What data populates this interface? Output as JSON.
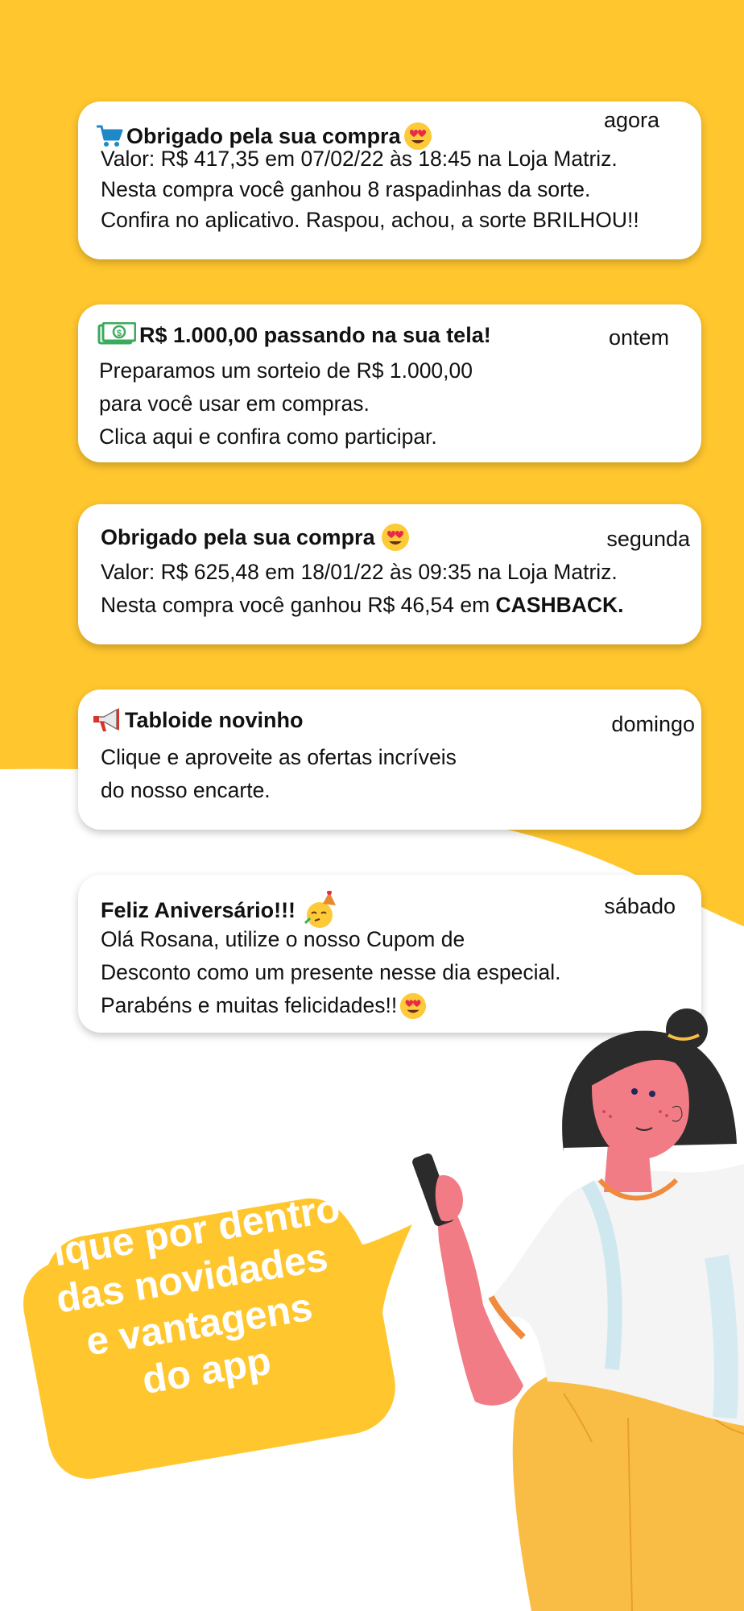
{
  "colors": {
    "yellow": "#FFC62E",
    "card_bg": "#FFFFFF",
    "text": "#111111",
    "cart_blue": "#1E88C8",
    "money_green": "#3BAA5C",
    "shirt": "#F4F4F4",
    "skin": "#F27C85",
    "pants": "#F9BD45",
    "hair": "#2B2B2B"
  },
  "notifications": [
    {
      "icon": "shopping-cart-icon",
      "title": "Obrigado pela sua compra",
      "title_emoji": "heart-eyes-emoji",
      "time": "agora",
      "lines": [
        "Valor: R$ 417,35 em 07/02/22 às 18:45 na Loja Matriz.",
        "Nesta compra você ganhou 8 raspadinhas da sorte.",
        "Confira no aplicativo. Raspou, achou, a sorte BRILHOU!!"
      ]
    },
    {
      "icon": "money-bill-icon",
      "title": "R$ 1.000,00 passando na sua tela!",
      "time": "ontem",
      "lines": [
        "Preparamos um sorteio de R$ 1.000,00",
        "para você usar em compras.",
        "Clica aqui e confira como participar."
      ]
    },
    {
      "title": "Obrigado pela sua compra",
      "title_emoji": "heart-eyes-emoji",
      "time": "segunda",
      "lines": [
        "Valor: R$ 625,48 em 18/01/22 às 09:35 na Loja Matriz."
      ],
      "line2_prefix": "Nesta compra você ganhou R$ 46,54 em ",
      "line2_bold": "CASHBACK."
    },
    {
      "icon": "megaphone-icon",
      "title": "Tabloide novinho",
      "time": "domingo",
      "lines": [
        "Clique e aproveite as ofertas incríveis",
        "do nosso encarte."
      ]
    },
    {
      "title": "Feliz Aniversário!!!",
      "title_emoji": "party-face-emoji",
      "time": "sábado",
      "lines": [
        "Olá Rosana, utilize o nosso Cupom de",
        "Desconto como um presente nesse dia especial."
      ],
      "line3_text": "Parabéns e muitas felicidades!!",
      "line3_emoji": "heart-eyes-emoji"
    }
  ],
  "bubble": {
    "lines": [
      "Fique por dentro",
      "das novidades",
      "e vantagens",
      "do app"
    ]
  },
  "illustration": "woman-holding-phone"
}
